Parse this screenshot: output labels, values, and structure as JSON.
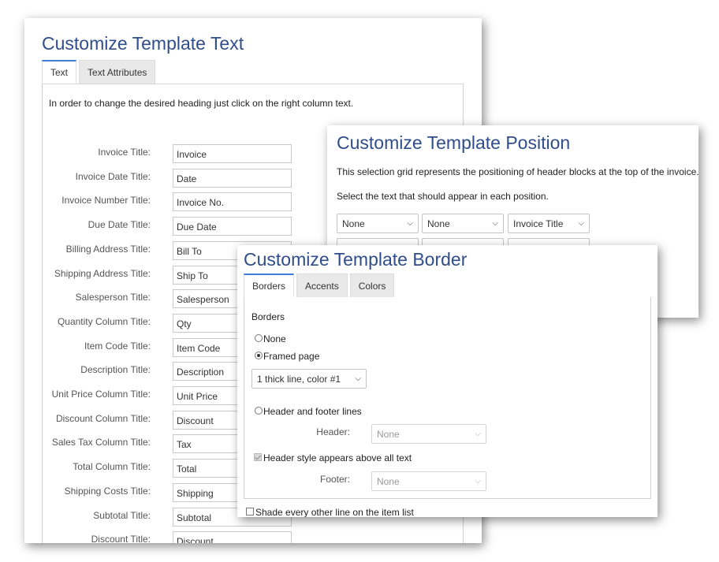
{
  "text_panel": {
    "title": "Customize Template Text",
    "tabs": [
      "Text",
      "Text Attributes"
    ],
    "instruction": "In order to change the desired heading just click on the right column text.",
    "fields": [
      {
        "label": "Invoice Title:",
        "value": "Invoice"
      },
      {
        "label": "Invoice Date Title:",
        "value": "Date"
      },
      {
        "label": "Invoice Number Title:",
        "value": "Invoice No."
      },
      {
        "label": "Due Date Title:",
        "value": "Due Date"
      },
      {
        "label": "Billing Address Title:",
        "value": "Bill To"
      },
      {
        "label": "Shipping Address Title:",
        "value": "Ship To"
      },
      {
        "label": "Salesperson Title:",
        "value": "Salesperson"
      },
      {
        "label": "Quantity Column Title:",
        "value": "Qty"
      },
      {
        "label": "Item Code Title:",
        "value": "Item Code"
      },
      {
        "label": "Description Title:",
        "value": "Description"
      },
      {
        "label": "Unit Price Column Title:",
        "value": "Unit Price"
      },
      {
        "label": "Discount Column Title:",
        "value": "Discount"
      },
      {
        "label": "Sales Tax Column Title:",
        "value": "Tax"
      },
      {
        "label": "Total Column Title:",
        "value": "Total"
      },
      {
        "label": "Shipping Costs Title:",
        "value": "Shipping"
      },
      {
        "label": "Subtotal Title:",
        "value": "Subtotal"
      },
      {
        "label": "Discount Title:",
        "value": "Discount"
      }
    ]
  },
  "position_panel": {
    "title": "Customize Template Position",
    "desc1": "This selection grid represents the positioning of header blocks at the top of the invoice.",
    "desc2": "Select the text that should appear in each position.",
    "row1": [
      "None",
      "None",
      "Invoice Title"
    ]
  },
  "border_panel": {
    "title": "Customize Template Border",
    "tabs": [
      "Borders",
      "Accents",
      "Colors"
    ],
    "section_label": "Borders",
    "option_none": "None",
    "option_framed": "Framed page",
    "frame_style": "1 thick line, color #1",
    "option_header_footer": "Header and footer lines",
    "header_label": "Header:",
    "header_value": "None",
    "header_above_label": "Header style appears above all text",
    "footer_label": "Footer:",
    "footer_value": "None",
    "shade_label": "Shade every other line on the item list"
  }
}
